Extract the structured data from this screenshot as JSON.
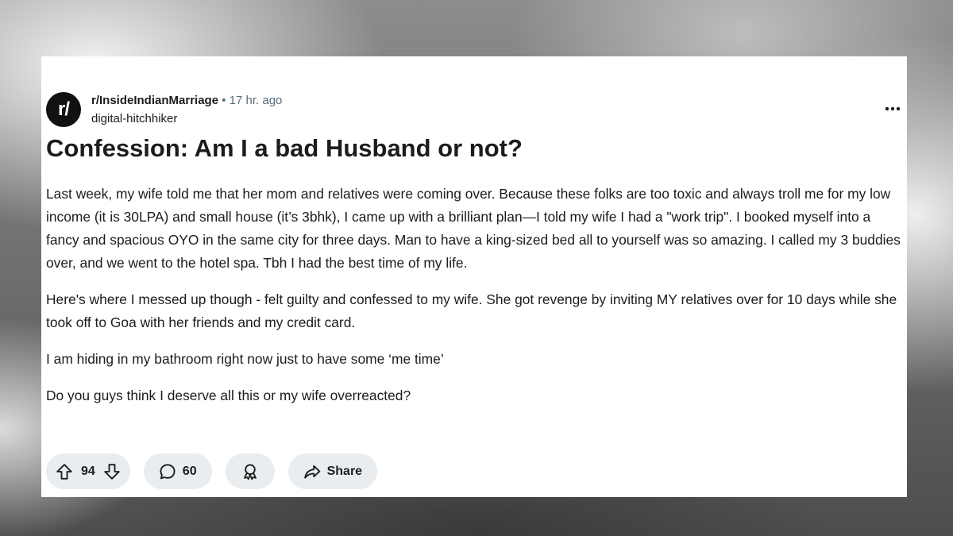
{
  "post": {
    "subreddit_avatar_text": "r/",
    "subreddit": "r/InsideIndianMarriage",
    "separator": "•",
    "time": "17 hr. ago",
    "author": "digital-hitchhiker",
    "title": "Confession: Am I a bad Husband or not?",
    "paragraphs": [
      "Last week, my wife told me that her mom and relatives were coming over. Because these folks are too toxic and always troll me for my low income (it is 30LPA) and small house (it’s 3bhk), I came up with a brilliant plan—I told my wife I had a \"work trip\". I booked myself into a fancy and spacious OYO in the same city for three days. Man to have a king-sized bed all to yourself was so amazing. I called my 3 buddies over, and we went to the hotel spa. Tbh I had the best time of my life.",
      "Here's where I messed up though - felt guilty and confessed to my wife. She got revenge by inviting MY relatives over for 10 days while she took off to Goa with her friends and my credit card.",
      "I am hiding in my bathroom right now just to have some ‘me time’",
      "Do you guys think I deserve all this or my wife overreacted?"
    ]
  },
  "actions": {
    "votes": "94",
    "comments": "60",
    "share_label": "Share"
  },
  "icons": {
    "more": "more-options-icon",
    "upvote": "upvote-arrow-icon",
    "downvote": "downvote-arrow-icon",
    "comment": "comment-bubble-icon",
    "award": "award-ribbon-icon",
    "share": "share-arrow-icon"
  },
  "colors": {
    "card_bg": "#ffffff",
    "text": "#1c1c1c",
    "meta": "#576f76",
    "pill_bg": "#eaedef",
    "avatar_bg": "#111111"
  }
}
